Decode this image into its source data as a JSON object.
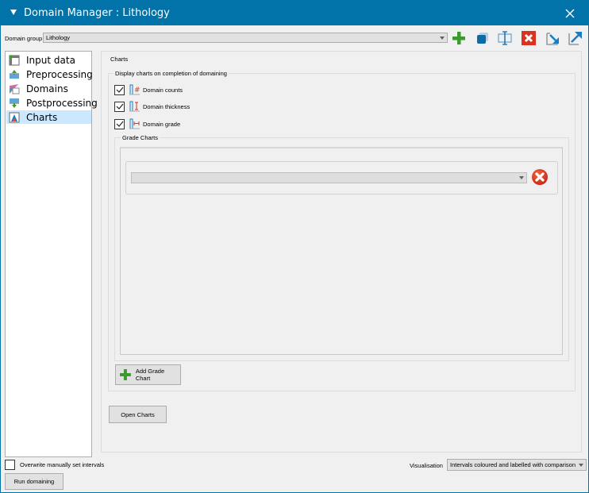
{
  "window": {
    "title": "Domain Manager : Lithology",
    "title_bar_color": "#0173a8"
  },
  "domain_group": {
    "label": "Domain group",
    "value": "Lithology"
  },
  "toolbar": {
    "icons": [
      "add-icon",
      "copy-icon",
      "rename-icon",
      "delete-icon",
      "import-icon",
      "export-icon"
    ]
  },
  "sidebar": {
    "items": [
      {
        "label": "Input data",
        "icon": "input-data-icon",
        "selected": false
      },
      {
        "label": "Preprocessing",
        "icon": "preprocessing-icon",
        "selected": false
      },
      {
        "label": "Domains",
        "icon": "domains-icon",
        "selected": false
      },
      {
        "label": "Postprocessing",
        "icon": "postprocessing-icon",
        "selected": false
      },
      {
        "label": "Charts",
        "icon": "charts-icon",
        "selected": true
      }
    ]
  },
  "charts_panel": {
    "title": "Charts",
    "display_group_title": "Display charts on completion of domaining",
    "options": [
      {
        "label": "Domain counts",
        "checked": true,
        "icon": "domain-counts-icon"
      },
      {
        "label": "Domain thickness",
        "checked": true,
        "icon": "domain-thickness-icon"
      },
      {
        "label": "Domain grade",
        "checked": true,
        "icon": "domain-grade-icon"
      }
    ],
    "grade_charts_title": "Grade Charts",
    "grade_chart_entries": [
      {
        "value": ""
      }
    ],
    "add_grade_chart_label": "Add Grade Chart",
    "open_charts_label": "Open Charts"
  },
  "footer": {
    "overwrite_label": "Overwrite manually set intervals",
    "overwrite_checked": false,
    "run_label": "Run domaining",
    "visualisation_label": "Visualisation",
    "visualisation_value": "Intervals coloured and labelled with comparison"
  }
}
